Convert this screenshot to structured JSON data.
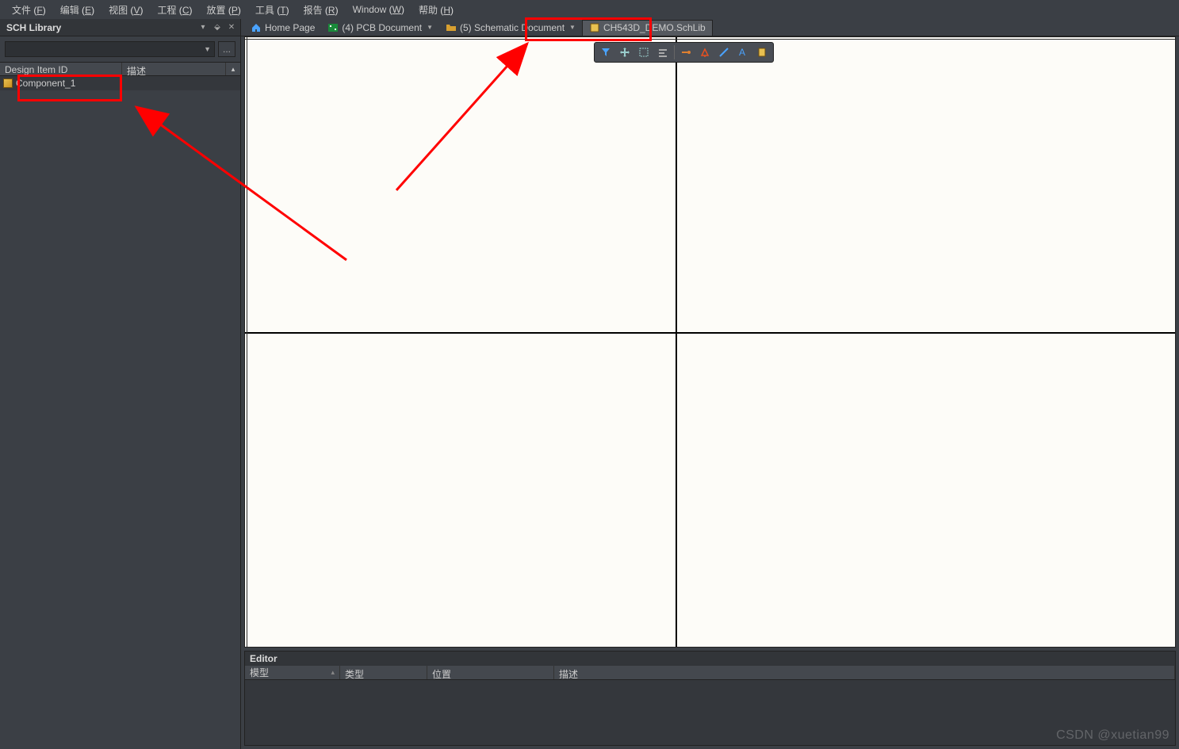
{
  "menu": {
    "items": [
      {
        "label": "文件",
        "ukey": "F"
      },
      {
        "label": "编辑",
        "ukey": "E"
      },
      {
        "label": "视图",
        "ukey": "V"
      },
      {
        "label": "工程",
        "ukey": "C"
      },
      {
        "label": "放置",
        "ukey": "P"
      },
      {
        "label": "工具",
        "ukey": "T"
      },
      {
        "label": "报告",
        "ukey": "R"
      },
      {
        "label": "Window",
        "ukey": "W"
      },
      {
        "label": "帮助",
        "ukey": "H"
      }
    ]
  },
  "left_panel": {
    "title": "SCH Library",
    "combo_value": "",
    "more_btn": "...",
    "columns": {
      "id": "Design Item ID",
      "desc": "描述"
    },
    "rows": [
      {
        "name": "Component_1"
      }
    ]
  },
  "doc_tabs": {
    "items": [
      {
        "label": "Home Page",
        "kind": "home"
      },
      {
        "label": "(4) PCB Document",
        "kind": "pcb",
        "dropdown": true
      },
      {
        "label": "(5) Schematic Document",
        "kind": "sch",
        "dropdown": true
      },
      {
        "label": "CH543D_DEMO.SchLib",
        "kind": "schlib",
        "active": true
      }
    ]
  },
  "float_toolbar": {
    "buttons": [
      "filter",
      "move",
      "select-rect",
      "align",
      "snap",
      "clear",
      "line",
      "text",
      "ieee"
    ]
  },
  "editor": {
    "title": "Editor",
    "columns": {
      "model": "模型",
      "type": "类型",
      "pos": "位置",
      "desc": "描述"
    }
  },
  "watermark": "CSDN @xuetian99"
}
